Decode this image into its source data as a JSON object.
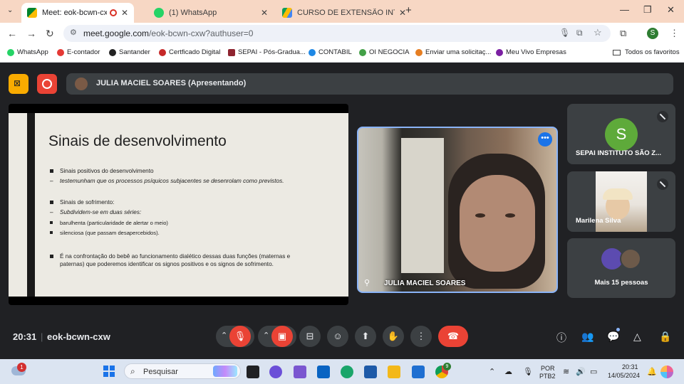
{
  "browser": {
    "tabs": [
      {
        "title": "Meet: eok-bcwn-cxw",
        "active": true
      },
      {
        "title": "(1) WhatsApp",
        "active": false
      },
      {
        "title": "CURSO DE EXTENSÃO INTRODU",
        "active": false
      }
    ],
    "url_host": "meet.google.com",
    "url_path": "/eok-bcwn-cxw?authuser=0",
    "profile_initial": "S",
    "bookmarks": [
      {
        "label": "WhatsApp",
        "color": "#25d366"
      },
      {
        "label": "E-contador",
        "color": "#e53935"
      },
      {
        "label": "Santander",
        "color": "#222222"
      },
      {
        "label": "Certficado Digital",
        "color": "#c62828"
      },
      {
        "label": "SEPAI - Pós-Gradua...",
        "color": "#8e2430"
      },
      {
        "label": "CONTABIL",
        "color": "#1e88e5"
      },
      {
        "label": "OI NEGOCIA",
        "color": "#43a047"
      },
      {
        "label": "Enviar uma solicitaç...",
        "color": "#e67e22"
      },
      {
        "label": "Meu Vivo Empresas",
        "color": "#7b1fa2"
      }
    ],
    "all_bookmarks_label": "Todos os favoritos"
  },
  "meet": {
    "presenter_label": "JULIA MACIEL SOARES (Apresentando)",
    "slide": {
      "title": "Sinais de desenvolvimento",
      "lines": [
        "Sinais positivos do desenvolvimento",
        "testemunham que os processos psíquicos subjacentes se desenrolam como previstos.",
        "Sinais de sofrimento:",
        "Subdividem-se em duas séries:",
        "barulhenta (particularidade de alertar o meio)",
        "silenciosa (que passam desapercebidos).",
        "É na confrontação do bebê ao funcionamento dialético dessas duas funções (maternas e paternas) que poderemos identificar os signos positivos e os signos de sofrimento."
      ]
    },
    "main_participant": "JULIA MACIEL SOARES",
    "side_tiles": [
      {
        "name": "SEPAI INSTITUTO SÃO Z...",
        "initial": "S",
        "avatar_color": "#5eaa3a"
      },
      {
        "name": "Marilena Silva"
      },
      {
        "name": "Mais 15 pessoas"
      }
    ],
    "time": "20:31",
    "meeting_code": "eok-bcwn-cxw"
  },
  "taskbar": {
    "search_placeholder": "Pesquisar",
    "notification_count": "1",
    "chrome_badge": "9",
    "language": "POR",
    "layout": "PTB2",
    "clock_time": "20:31",
    "clock_date": "14/05/2024"
  }
}
